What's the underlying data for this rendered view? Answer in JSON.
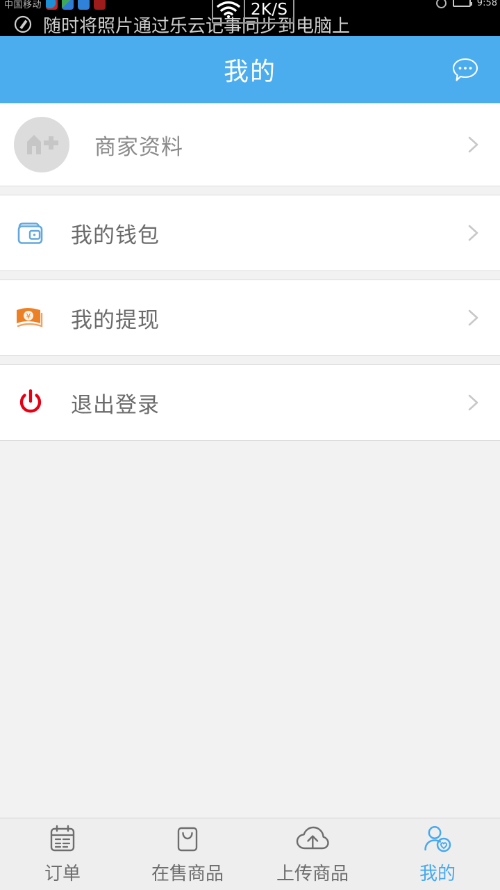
{
  "statusbar": {
    "carrier": "中国移动",
    "clock": "9:58",
    "network_speed": "2K/S",
    "notification_text": "随时将照片通过乐云记事同步到电脑上",
    "notification_icon": "compose-icon",
    "wifi_icon": "wifi-icon",
    "battery_icon": "battery-icon",
    "app_icons": [
      "twitter-icon",
      "gmail-icon",
      "mail-icon",
      "news-icon"
    ]
  },
  "header": {
    "title": "我的",
    "chat_icon": "chat-bubble-icon",
    "background_color": "#4cadee",
    "title_color": "#ffffff"
  },
  "list": {
    "groups": [
      {
        "rows": [
          {
            "label": "商家资料",
            "icon": "merchant-avatar-icon",
            "icon_type": "avatar",
            "chevron": "chevron-right-icon"
          }
        ]
      },
      {
        "rows": [
          {
            "label": "我的钱包",
            "icon": "wallet-icon",
            "icon_type": "wallet",
            "icon_color": "#63a8dd",
            "chevron": "chevron-right-icon"
          }
        ]
      },
      {
        "rows": [
          {
            "label": "我的提现",
            "icon": "banknote-yuan-icon",
            "icon_type": "banknote",
            "icon_color": "#ec8025",
            "chevron": "chevron-right-icon"
          }
        ]
      },
      {
        "rows": [
          {
            "label": "退出登录",
            "icon": "power-off-icon",
            "icon_type": "power",
            "icon_color": "#e60012",
            "chevron": "chevron-right-icon"
          }
        ]
      }
    ]
  },
  "tabbar": {
    "active_color": "#46a9ef",
    "inactive_color": "#6d6d6d",
    "tabs": [
      {
        "label": "订单",
        "icon": "calendar-order-icon",
        "active": false
      },
      {
        "label": "在售商品",
        "icon": "shopping-bag-icon",
        "active": false
      },
      {
        "label": "上传商品",
        "icon": "cloud-upload-icon",
        "active": false
      },
      {
        "label": "我的",
        "icon": "user-heart-icon",
        "active": true
      }
    ]
  }
}
